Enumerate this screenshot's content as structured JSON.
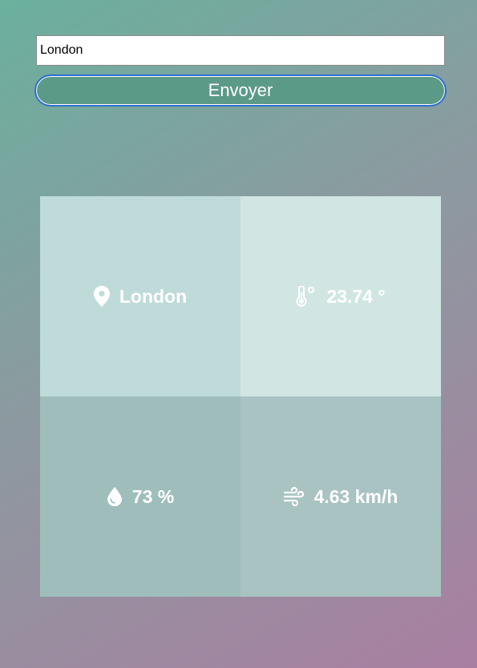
{
  "search": {
    "value": "London"
  },
  "send_button": {
    "label": "Envoyer"
  },
  "weather": {
    "city": "London",
    "temperature": "23.74 °",
    "humidity": "73 %",
    "wind": "4.63 km/h"
  },
  "icons": {
    "city": "map-pin-icon",
    "temperature": "thermometer-icon",
    "humidity": "water-drop-icon",
    "wind": "wind-icon"
  }
}
